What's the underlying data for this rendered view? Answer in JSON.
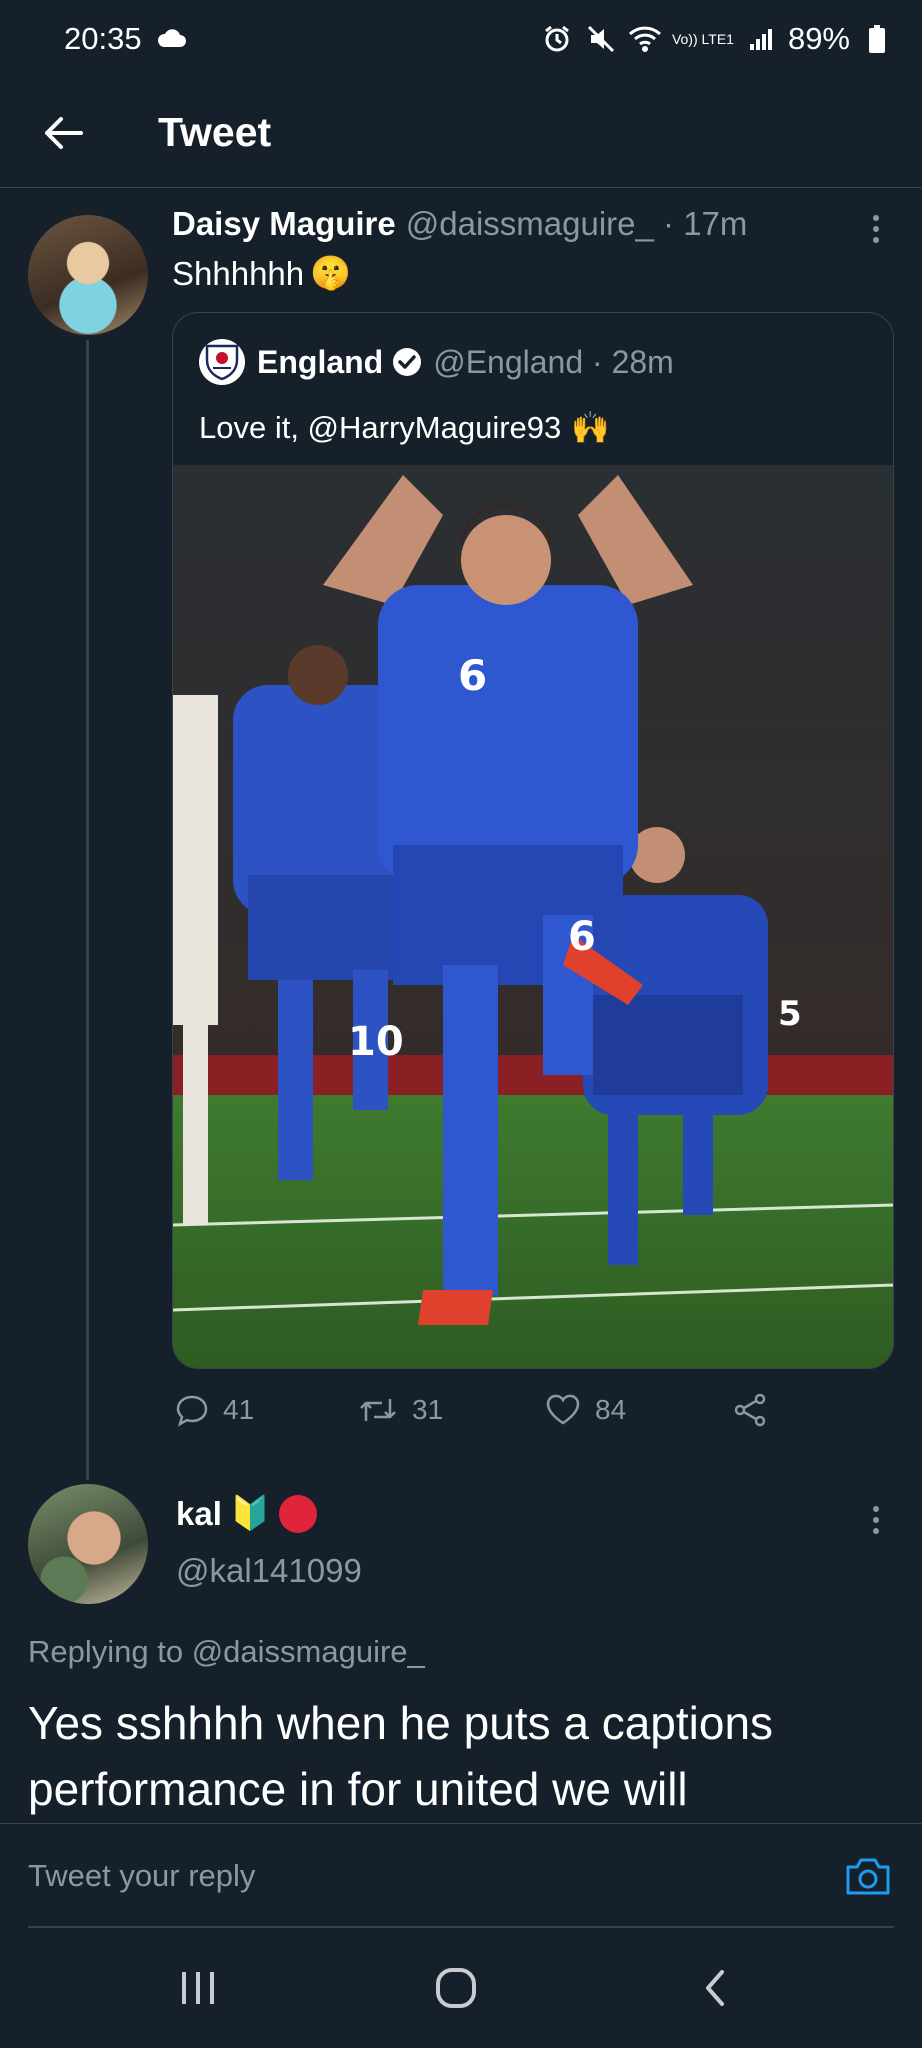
{
  "status": {
    "time": "20:35",
    "network": "Vo)) LTE1",
    "battery": "89%"
  },
  "appbar": {
    "title": "Tweet"
  },
  "tweet": {
    "name": "Daisy Maguire",
    "handle": "@daissmaguire_ · 17m",
    "text": "Shhhhhh",
    "text_emoji": "🤫",
    "quote": {
      "name": "England",
      "handle": "@England · 28m",
      "text": "Love it, @HarryMaguire93",
      "text_emoji": "🙌"
    },
    "actions": {
      "replies": "41",
      "retweets": "31",
      "likes": "84"
    }
  },
  "reply": {
    "name": "kal",
    "name_emoji": "🔰",
    "handle": "@kal141099",
    "replying_to": "Replying to @daissmaguire_",
    "text": "Yes sshhhh when he puts a captions performance in for united we will"
  },
  "composer": {
    "placeholder": "Tweet your reply"
  },
  "colors": {
    "background": "#15202b",
    "border": "#38444d",
    "secondary_text": "#8899a6",
    "accent": "#1d9bf0",
    "red_dot": "#e0243a"
  },
  "icons": {
    "back": "arrow-left-icon",
    "more": "more-vertical-icon",
    "reply": "comment-icon",
    "retweet": "retweet-icon",
    "like": "heart-icon",
    "share": "share-icon",
    "camera": "camera-icon",
    "verified": "verified-badge-icon"
  }
}
